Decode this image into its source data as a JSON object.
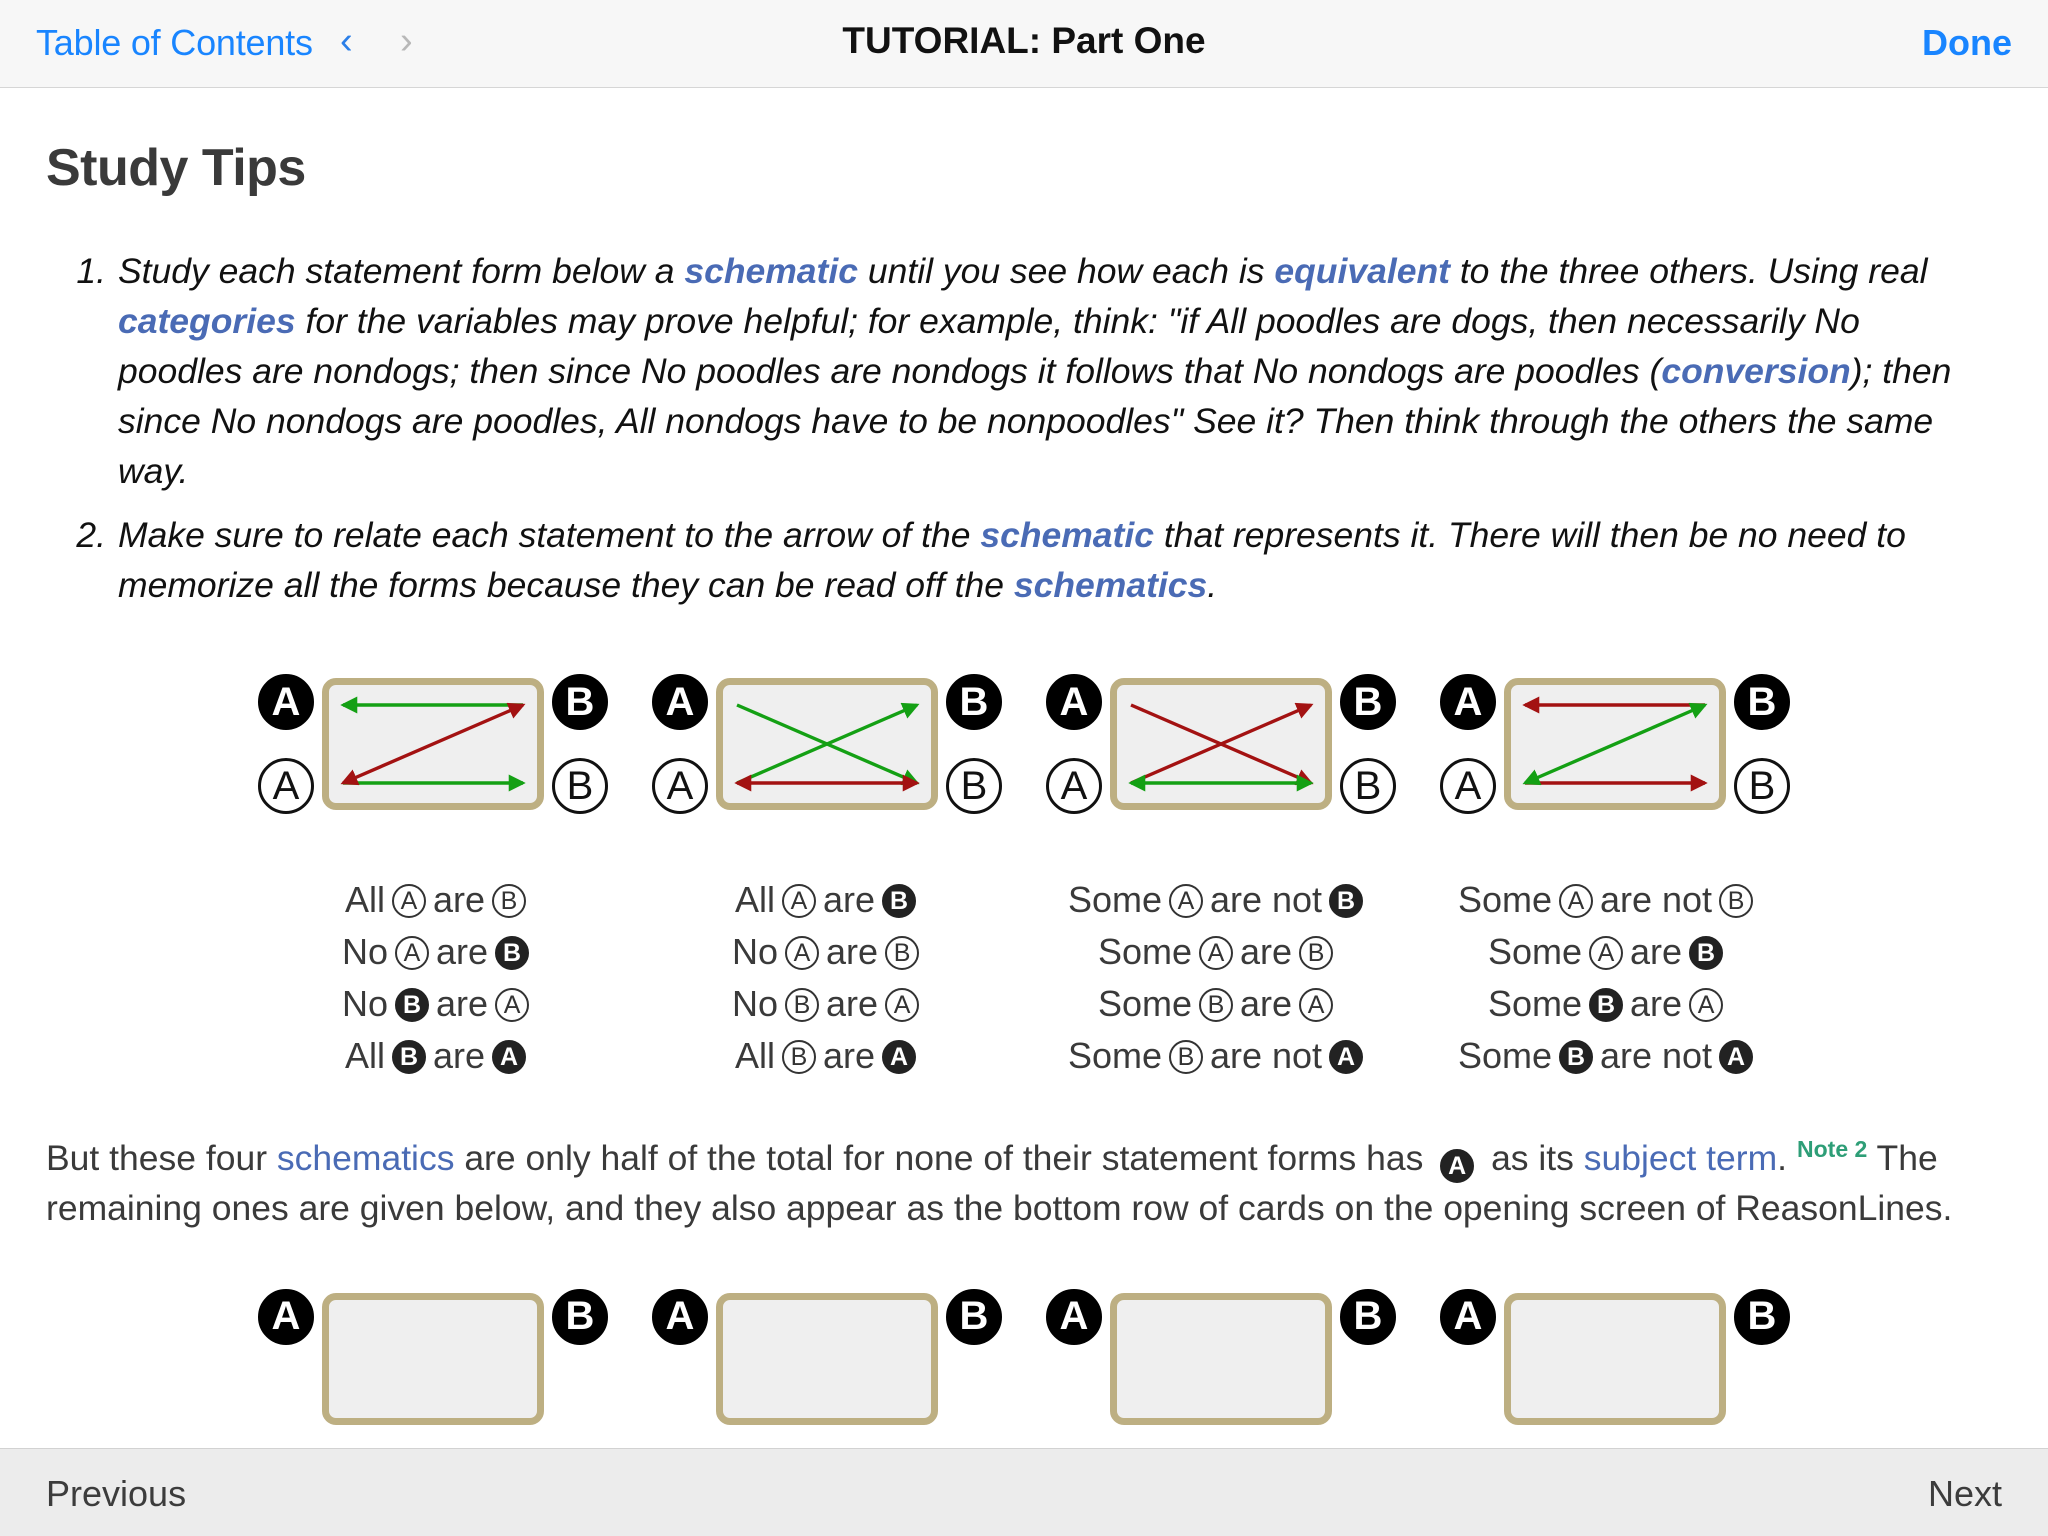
{
  "topbar": {
    "toc_label": "Table of Contents",
    "prev_arrow": "‹",
    "next_arrow": "›",
    "title": "TUTORIAL: Part One",
    "done_label": "Done"
  },
  "page": {
    "title": "Study Tips"
  },
  "tips": [
    {
      "parts": [
        {
          "t": "Study each statement form below a ",
          "k": "plain"
        },
        {
          "t": "schematic",
          "k": "link"
        },
        {
          "t": " until you see how each is ",
          "k": "plain"
        },
        {
          "t": "equivalent",
          "k": "link"
        },
        {
          "t": " to the three others. Using real ",
          "k": "plain"
        },
        {
          "t": "categories",
          "k": "link"
        },
        {
          "t": " for the variables may prove helpful; for example, think: \"if All poodles are dogs, then necessarily No poodles are nondogs; then since No poodles are nondogs it follows that No nondogs are poodles (",
          "k": "plain"
        },
        {
          "t": "conversion",
          "k": "link"
        },
        {
          "t": "); then since No nondogs are poodles, All nondogs have to be nonpoodles\" See it? Then think through the others the same way.",
          "k": "plain"
        }
      ]
    },
    {
      "parts": [
        {
          "t": "Make sure to relate each statement to the arrow of the ",
          "k": "plain"
        },
        {
          "t": "schematic",
          "k": "link"
        },
        {
          "t": " that represents it. There will then be no need to memorize all the forms because they can be read off the ",
          "k": "plain"
        },
        {
          "t": "schematics",
          "k": "link"
        },
        {
          "t": ".",
          "k": "plain"
        }
      ]
    }
  ],
  "schematics": [
    {
      "name": "schematic-1",
      "tokens": {
        "top_left": {
          "letter": "A",
          "style": "filled"
        },
        "bottom_left": {
          "letter": "A",
          "style": "open"
        },
        "top_right": {
          "letter": "B",
          "style": "filled"
        },
        "bottom_right": {
          "letter": "B",
          "style": "open"
        }
      },
      "arrows": [
        {
          "type": "horizontal-top",
          "color": "#14a014",
          "direction": "left"
        },
        {
          "type": "horizontal-bottom",
          "color": "#14a014",
          "direction": "right"
        },
        {
          "type": "diagonal-up",
          "color": "#a31212",
          "direction": "both"
        }
      ]
    },
    {
      "name": "schematic-2",
      "tokens": {
        "top_left": {
          "letter": "A",
          "style": "filled"
        },
        "bottom_left": {
          "letter": "A",
          "style": "open"
        },
        "top_right": {
          "letter": "B",
          "style": "filled"
        },
        "bottom_right": {
          "letter": "B",
          "style": "open"
        }
      },
      "arrows": [
        {
          "type": "diagonal-down",
          "color": "#14a014",
          "direction": "left"
        },
        {
          "type": "diagonal-up",
          "color": "#14a014",
          "direction": "right"
        },
        {
          "type": "horizontal-bottom",
          "color": "#a31212",
          "direction": "both"
        }
      ]
    },
    {
      "name": "schematic-3",
      "tokens": {
        "top_left": {
          "letter": "A",
          "style": "filled"
        },
        "bottom_left": {
          "letter": "A",
          "style": "open"
        },
        "top_right": {
          "letter": "B",
          "style": "filled"
        },
        "bottom_right": {
          "letter": "B",
          "style": "open"
        }
      },
      "arrows": [
        {
          "type": "diagonal-down",
          "color": "#a31212",
          "direction": "left"
        },
        {
          "type": "diagonal-up",
          "color": "#a31212",
          "direction": "right"
        },
        {
          "type": "horizontal-bottom",
          "color": "#14a014",
          "direction": "both"
        }
      ]
    },
    {
      "name": "schematic-4",
      "tokens": {
        "top_left": {
          "letter": "A",
          "style": "filled"
        },
        "bottom_left": {
          "letter": "A",
          "style": "open"
        },
        "top_right": {
          "letter": "B",
          "style": "filled"
        },
        "bottom_right": {
          "letter": "B",
          "style": "open"
        }
      },
      "arrows": [
        {
          "type": "horizontal-top",
          "color": "#a31212",
          "direction": "left"
        },
        {
          "type": "horizontal-bottom",
          "color": "#a31212",
          "direction": "right"
        },
        {
          "type": "diagonal-up",
          "color": "#14a014",
          "direction": "both"
        }
      ]
    }
  ],
  "statement_columns": [
    {
      "lines": [
        {
          "pre": "All",
          "t1": {
            "letter": "A",
            "style": "open"
          },
          "mid": "are",
          "t2": {
            "letter": "B",
            "style": "open"
          },
          "post": ""
        },
        {
          "pre": "No",
          "t1": {
            "letter": "A",
            "style": "open"
          },
          "mid": "are",
          "t2": {
            "letter": "B",
            "style": "filled"
          },
          "post": ""
        },
        {
          "pre": "No",
          "t1": {
            "letter": "B",
            "style": "filled"
          },
          "mid": "are",
          "t2": {
            "letter": "A",
            "style": "open"
          },
          "post": ""
        },
        {
          "pre": "All",
          "t1": {
            "letter": "B",
            "style": "filled"
          },
          "mid": "are",
          "t2": {
            "letter": "A",
            "style": "filled"
          },
          "post": ""
        }
      ]
    },
    {
      "lines": [
        {
          "pre": "All",
          "t1": {
            "letter": "A",
            "style": "open"
          },
          "mid": "are",
          "t2": {
            "letter": "B",
            "style": "filled"
          },
          "post": ""
        },
        {
          "pre": "No",
          "t1": {
            "letter": "A",
            "style": "open"
          },
          "mid": "are",
          "t2": {
            "letter": "B",
            "style": "open"
          },
          "post": ""
        },
        {
          "pre": "No",
          "t1": {
            "letter": "B",
            "style": "open"
          },
          "mid": "are",
          "t2": {
            "letter": "A",
            "style": "open"
          },
          "post": ""
        },
        {
          "pre": "All",
          "t1": {
            "letter": "B",
            "style": "open"
          },
          "mid": "are",
          "t2": {
            "letter": "A",
            "style": "filled"
          },
          "post": ""
        }
      ]
    },
    {
      "lines": [
        {
          "pre": "Some",
          "t1": {
            "letter": "A",
            "style": "open"
          },
          "mid": "are not",
          "t2": {
            "letter": "B",
            "style": "filled"
          },
          "post": ""
        },
        {
          "pre": "Some",
          "t1": {
            "letter": "A",
            "style": "open"
          },
          "mid": "are",
          "t2": {
            "letter": "B",
            "style": "open"
          },
          "post": ""
        },
        {
          "pre": "Some",
          "t1": {
            "letter": "B",
            "style": "open"
          },
          "mid": "are",
          "t2": {
            "letter": "A",
            "style": "open"
          },
          "post": ""
        },
        {
          "pre": "Some",
          "t1": {
            "letter": "B",
            "style": "open"
          },
          "mid": "are not",
          "t2": {
            "letter": "A",
            "style": "filled"
          },
          "post": ""
        }
      ]
    },
    {
      "lines": [
        {
          "pre": "Some",
          "t1": {
            "letter": "A",
            "style": "open"
          },
          "mid": "are not",
          "t2": {
            "letter": "B",
            "style": "open"
          },
          "post": ""
        },
        {
          "pre": "Some",
          "t1": {
            "letter": "A",
            "style": "open"
          },
          "mid": "are",
          "t2": {
            "letter": "B",
            "style": "filled"
          },
          "post": ""
        },
        {
          "pre": "Some",
          "t1": {
            "letter": "B",
            "style": "filled"
          },
          "mid": "are",
          "t2": {
            "letter": "A",
            "style": "open"
          },
          "post": ""
        },
        {
          "pre": "Some",
          "t1": {
            "letter": "B",
            "style": "filled"
          },
          "mid": "are not",
          "t2": {
            "letter": "A",
            "style": "filled"
          },
          "post": ""
        }
      ]
    }
  ],
  "closing": {
    "parts": [
      {
        "t": "But these four ",
        "k": "plain"
      },
      {
        "t": "schematics",
        "k": "link"
      },
      {
        "t": " are only half of the total for none of their statement forms has ",
        "k": "plain"
      },
      {
        "t": "",
        "k": "token",
        "letter": "A",
        "style": "filled"
      },
      {
        "t": " as its ",
        "k": "plain"
      },
      {
        "t": "subject term",
        "k": "link"
      },
      {
        "t": ".",
        "k": "plain"
      },
      {
        "t": "Note 2",
        "k": "note"
      },
      {
        "t": " The remaining ones are given below, and they also appear as the bottom row of cards on the opening screen of ReasonLines.",
        "k": "plain"
      }
    ]
  },
  "bottom_schematics": [
    {
      "name": "bottom-schematic-1",
      "tokens": {
        "top_left": {
          "letter": "A",
          "style": "filled"
        },
        "top_right": {
          "letter": "B",
          "style": "filled"
        }
      }
    },
    {
      "name": "bottom-schematic-2",
      "tokens": {
        "top_left": {
          "letter": "A",
          "style": "filled"
        },
        "top_right": {
          "letter": "B",
          "style": "filled"
        }
      }
    },
    {
      "name": "bottom-schematic-3",
      "tokens": {
        "top_left": {
          "letter": "A",
          "style": "filled"
        },
        "top_right": {
          "letter": "B",
          "style": "filled"
        }
      }
    },
    {
      "name": "bottom-schematic-4",
      "tokens": {
        "top_left": {
          "letter": "A",
          "style": "filled"
        },
        "top_right": {
          "letter": "B",
          "style": "filled"
        }
      }
    }
  ],
  "bottombar": {
    "previous_label": "Previous",
    "next_label": "Next"
  },
  "colors": {
    "link_blue": "#4a6bb5",
    "nav_blue": "#1985ff",
    "arrow_green": "#14a014",
    "arrow_red": "#a31212",
    "card_border": "#bdaf82",
    "card_fill": "#efefef",
    "note_green": "#2e9e77"
  }
}
